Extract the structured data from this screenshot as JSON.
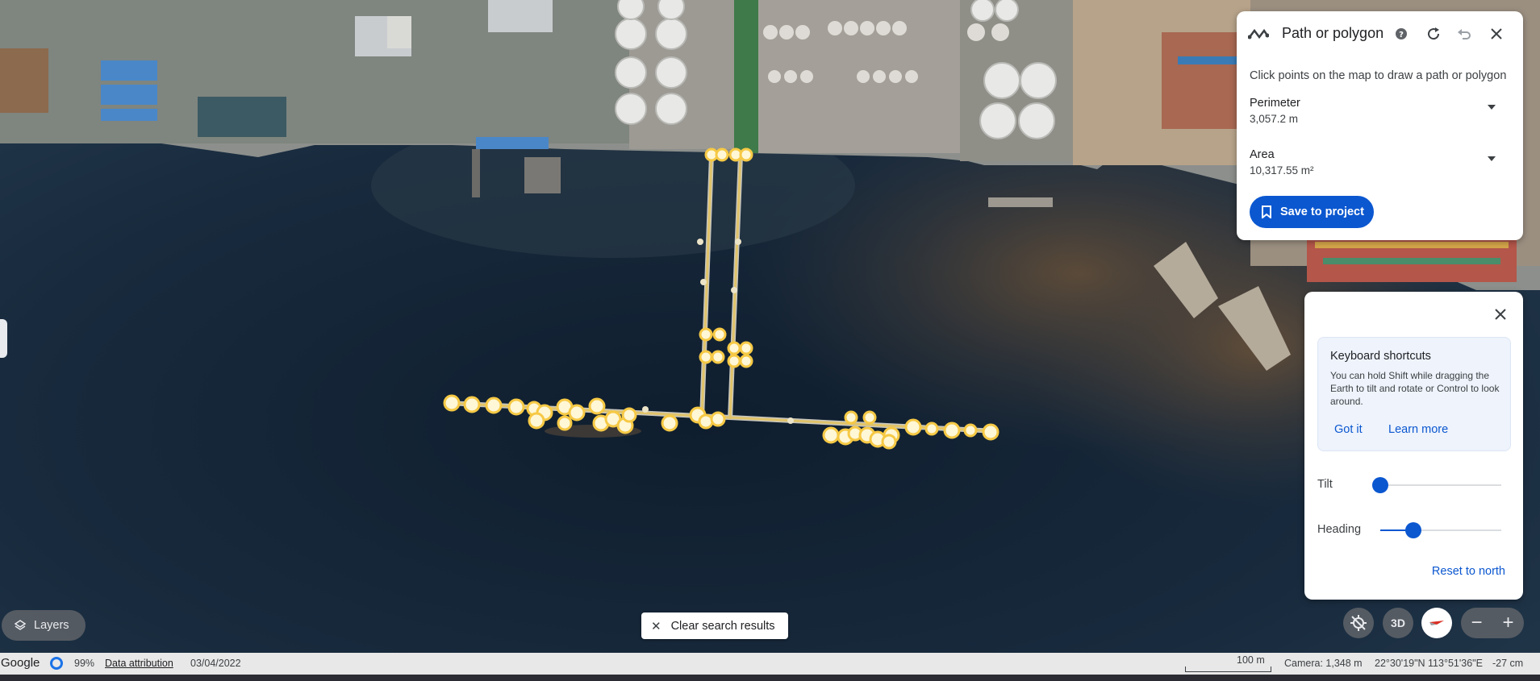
{
  "map": {
    "description_type": "satellite",
    "pin_color": "#f6c945"
  },
  "path_panel": {
    "title": "Path or polygon",
    "instruction": "Click points on the map to draw a path or polygon",
    "perimeter_label": "Perimeter",
    "perimeter_value": "3,057.2 m",
    "area_label": "Area",
    "area_value": "10,317.55 m²",
    "save_label": "Save to project"
  },
  "nav_panel": {
    "tip_title": "Keyboard shortcuts",
    "tip_body": "You can hold Shift while dragging the Earth to tilt and rotate or Control to look around.",
    "got_it": "Got it",
    "learn_more": "Learn more",
    "tilt_label": "Tilt",
    "tilt_value": 0,
    "heading_label": "Heading",
    "heading_value": 0.27,
    "reset_label": "Reset to north"
  },
  "controls": {
    "layers_label": "Layers",
    "clear_label": "Clear search results",
    "three_d_label": "3D",
    "zoom_out": "−",
    "zoom_in": "+"
  },
  "status": {
    "logo": "Google",
    "load_pct": "99%",
    "attribution": "Data attribution",
    "date": "03/04/2022",
    "scale": "100 m",
    "camera": "Camera: 1,348 m",
    "coords": "22°30'19\"N 113°51'36\"E",
    "elevation": "-27 cm"
  },
  "colors": {
    "accent": "#0b57d0",
    "water": "#1a2c3f"
  }
}
